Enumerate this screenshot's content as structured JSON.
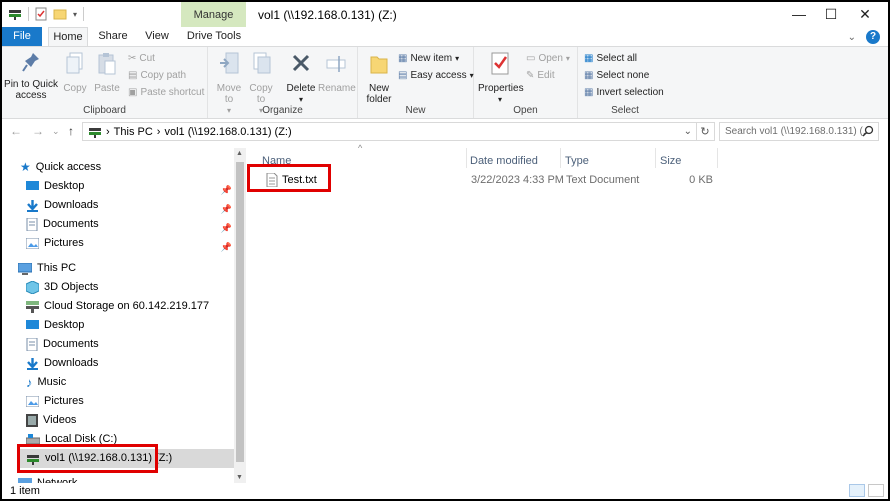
{
  "window": {
    "title": "vol1 (\\\\192.168.0.131) (Z:)",
    "context_tab": "Manage"
  },
  "tabs": [
    "File",
    "Home",
    "Share",
    "View",
    "Drive Tools"
  ],
  "ribbon": {
    "clipboard": {
      "label": "Clipboard",
      "pin": "Pin to Quick access",
      "copy": "Copy",
      "paste": "Paste",
      "cut": "Cut",
      "copy_path": "Copy path",
      "paste_shortcut": "Paste shortcut"
    },
    "organize": {
      "label": "Organize",
      "move_to": "Move to",
      "copy_to": "Copy to",
      "delete": "Delete",
      "rename": "Rename"
    },
    "new": {
      "label": "New",
      "new_folder": "New folder",
      "new_item": "New item",
      "easy_access": "Easy access"
    },
    "open": {
      "label": "Open",
      "properties": "Properties",
      "open": "Open",
      "edit": "Edit"
    },
    "select": {
      "label": "Select",
      "select_all": "Select all",
      "select_none": "Select none",
      "invert": "Invert selection"
    }
  },
  "address": {
    "crumbs": [
      "This PC",
      "vol1 (\\\\192.168.0.131) (Z:)"
    ],
    "search_placeholder": "Search vol1 (\\\\192.168.0.131) (..."
  },
  "nav": {
    "quick_access": "Quick access",
    "quick_items": [
      "Desktop",
      "Downloads",
      "Documents",
      "Pictures"
    ],
    "this_pc": "This PC",
    "pc_items": [
      "3D Objects",
      "Cloud Storage on 60.142.219.177",
      "Desktop",
      "Documents",
      "Downloads",
      "Music",
      "Pictures",
      "Videos",
      "Local Disk (C:)",
      "vol1 (\\\\192.168.0.131) (Z:)"
    ],
    "network": "Network"
  },
  "columns": {
    "name": "Name",
    "date": "Date modified",
    "type": "Type",
    "size": "Size"
  },
  "files": [
    {
      "name": "Test.txt",
      "date": "3/22/2023 4:33 PM",
      "type": "Text Document",
      "size": "0 KB"
    }
  ],
  "status": {
    "count": "1 item"
  },
  "colors": {
    "accent": "#1979ca",
    "manage_tab": "#d5e8bf",
    "highlight": "#e00000"
  }
}
